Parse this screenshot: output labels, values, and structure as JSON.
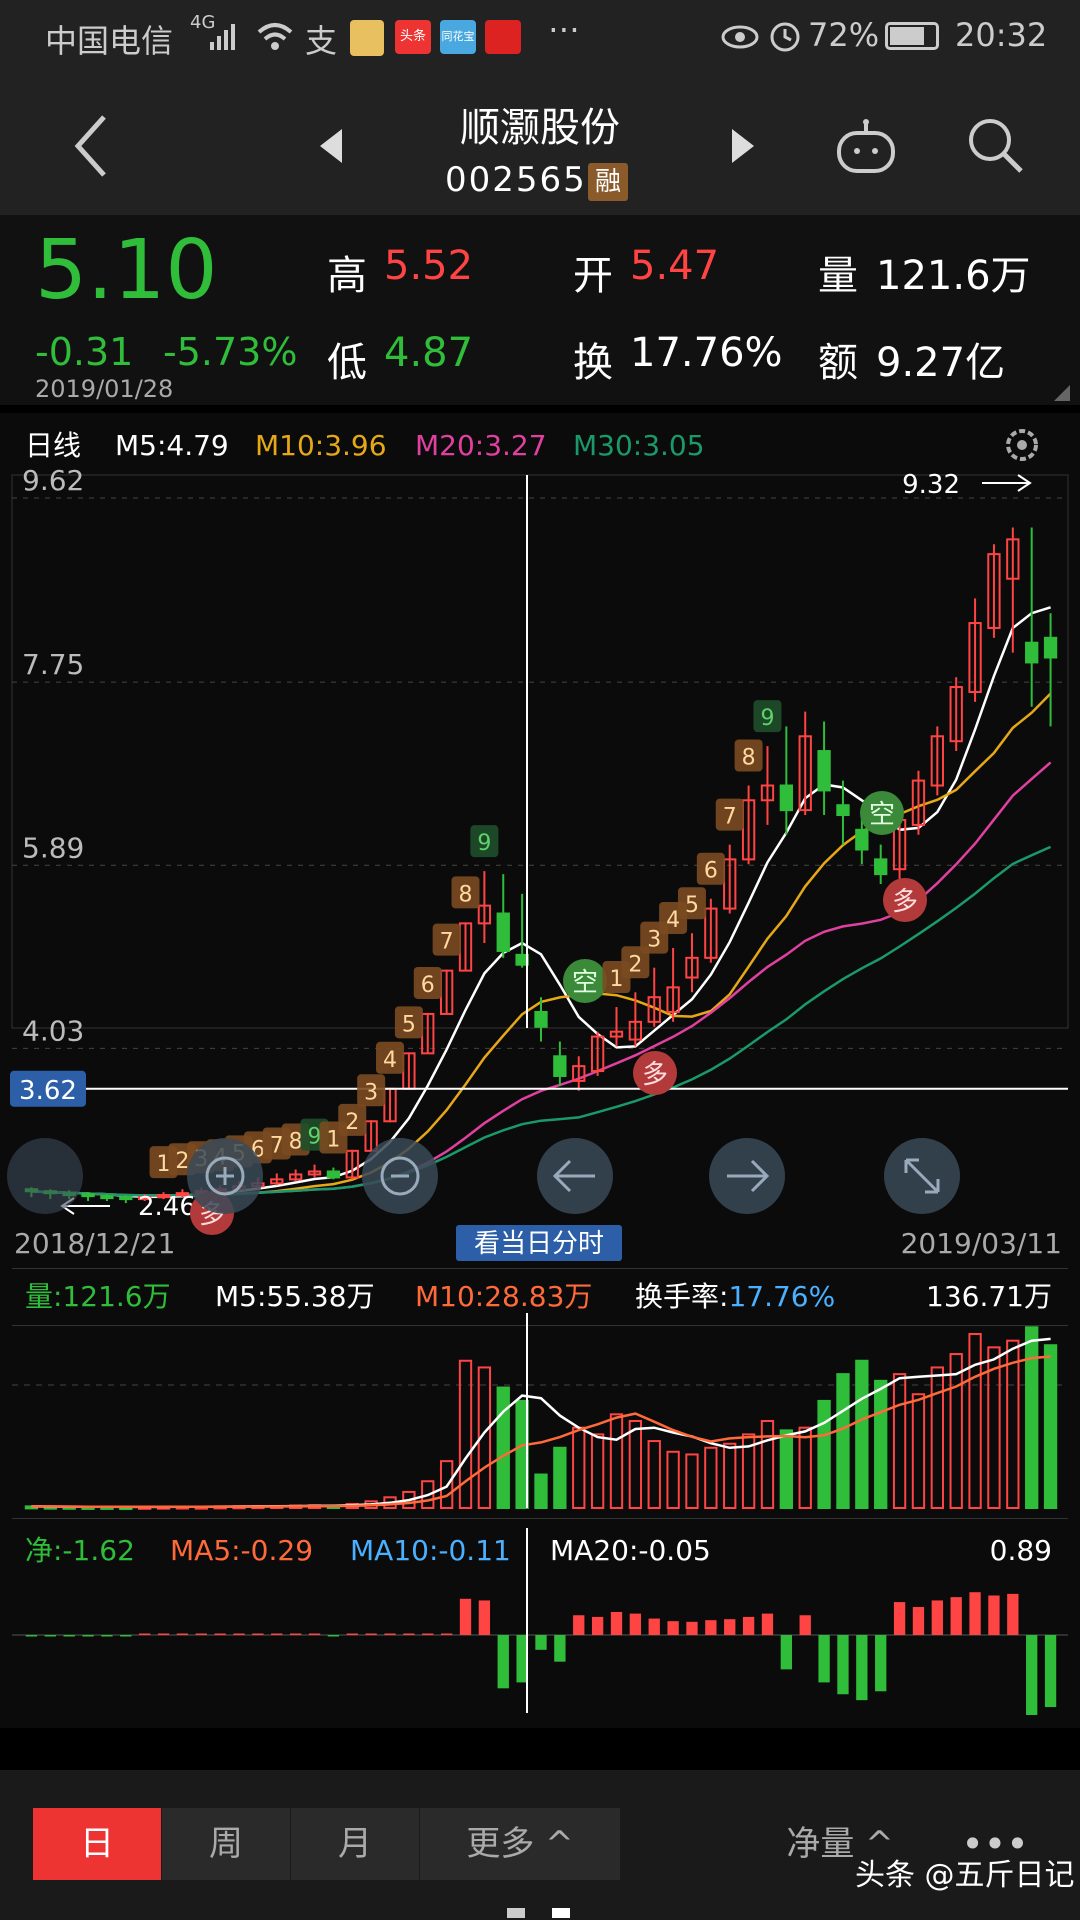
{
  "status": {
    "carrier": "中国电信",
    "signal": "4G",
    "battery": "72%",
    "time": "20:32",
    "apps": [
      "头条",
      "同花宝"
    ]
  },
  "header": {
    "title": "顺灏股份",
    "code": "002565",
    "badge": "融"
  },
  "quote": {
    "price": "5.10",
    "change": "-0.31",
    "change_pct": "-5.73%",
    "date": "2019/01/28",
    "high_label": "高",
    "high": "5.52",
    "open_label": "开",
    "open": "5.47",
    "volume_label": "量",
    "volume": "121.6万",
    "low_label": "低",
    "low": "4.87",
    "turnover_label": "换",
    "turnover": "17.76%",
    "amount_label": "额",
    "amount": "9.27亿"
  },
  "kline": {
    "period_label": "日线",
    "m5": "M5:4.79",
    "m10": "M10:3.96",
    "m20": "M20:3.27",
    "m30": "M30:3.05",
    "y_labels": [
      "9.62",
      "7.75",
      "5.89",
      "4.03"
    ],
    "crosshair_price": "3.62",
    "max_label": "9.32",
    "min_label": "2.46",
    "start_date": "2018/12/21",
    "end_date": "2019/03/11",
    "intraday_button": "看当日分时",
    "sig_duo": "多",
    "sig_kong": "空"
  },
  "volume": {
    "label": "量:121.6万",
    "m5": "M5:55.38万",
    "m10": "M10:28.83万",
    "turnover": "换手率:17.76%",
    "max": "136.71万"
  },
  "net": {
    "label": "净:-1.62",
    "ma5": "MA5:-0.29",
    "ma10": "MA10:-0.11",
    "ma20": "MA20:-0.05",
    "max": "0.89"
  },
  "tabs": [
    "日",
    "周",
    "月",
    "更多"
  ],
  "indicator_selector": "净量",
  "watermark": "头条 @五斤日记",
  "colors": {
    "up": "#ff4444",
    "down": "#2fbd3a",
    "m10": "#e6a817",
    "m20": "#e040a0",
    "m30": "#1a9a6a"
  },
  "chart_data": {
    "type": "candlestick",
    "y_range": [
      2.46,
      9.62
    ],
    "candles": [
      {
        "o": 2.6,
        "c": 2.58,
        "h": 2.62,
        "l": 2.52
      },
      {
        "o": 2.58,
        "c": 2.56,
        "h": 2.6,
        "l": 2.5
      },
      {
        "o": 2.56,
        "c": 2.55,
        "h": 2.59,
        "l": 2.5
      },
      {
        "o": 2.55,
        "c": 2.53,
        "h": 2.57,
        "l": 2.48
      },
      {
        "o": 2.53,
        "c": 2.52,
        "h": 2.55,
        "l": 2.48
      },
      {
        "o": 2.52,
        "c": 2.5,
        "h": 2.54,
        "l": 2.46
      },
      {
        "o": 2.5,
        "c": 2.52,
        "h": 2.55,
        "l": 2.48
      },
      {
        "o": 2.52,
        "c": 2.54,
        "h": 2.57,
        "l": 2.5
      },
      {
        "o": 2.54,
        "c": 2.56,
        "h": 2.6,
        "l": 2.52
      },
      {
        "o": 2.56,
        "c": 2.58,
        "h": 2.62,
        "l": 2.54
      },
      {
        "o": 2.58,
        "c": 2.6,
        "h": 2.64,
        "l": 2.56
      },
      {
        "o": 2.6,
        "c": 2.63,
        "h": 2.68,
        "l": 2.58
      },
      {
        "o": 2.63,
        "c": 2.66,
        "h": 2.72,
        "l": 2.61
      },
      {
        "o": 2.66,
        "c": 2.7,
        "h": 2.76,
        "l": 2.64
      },
      {
        "o": 2.7,
        "c": 2.75,
        "h": 2.8,
        "l": 2.68
      },
      {
        "o": 2.75,
        "c": 2.78,
        "h": 2.85,
        "l": 2.72
      },
      {
        "o": 2.78,
        "c": 2.72,
        "h": 2.82,
        "l": 2.7
      },
      {
        "o": 2.72,
        "c": 2.99,
        "h": 3.0,
        "l": 2.7
      },
      {
        "o": 2.99,
        "c": 3.29,
        "h": 3.3,
        "l": 2.98
      },
      {
        "o": 3.29,
        "c": 3.62,
        "h": 3.63,
        "l": 3.28
      },
      {
        "o": 3.62,
        "c": 3.98,
        "h": 3.99,
        "l": 3.62
      },
      {
        "o": 3.98,
        "c": 4.38,
        "h": 4.39,
        "l": 3.98
      },
      {
        "o": 4.38,
        "c": 4.82,
        "h": 4.83,
        "l": 4.38
      },
      {
        "o": 4.82,
        "c": 5.3,
        "h": 5.31,
        "l": 4.82
      },
      {
        "o": 5.3,
        "c": 5.48,
        "h": 5.83,
        "l": 5.1
      },
      {
        "o": 5.4,
        "c": 5.02,
        "h": 5.8,
        "l": 4.95
      },
      {
        "o": 4.98,
        "c": 4.88,
        "h": 5.6,
        "l": 4.85
      },
      {
        "o": 4.4,
        "c": 4.25,
        "h": 4.55,
        "l": 4.1
      },
      {
        "o": 3.95,
        "c": 3.75,
        "h": 4.1,
        "l": 3.65
      },
      {
        "o": 3.7,
        "c": 3.85,
        "h": 3.95,
        "l": 3.6
      },
      {
        "o": 3.8,
        "c": 4.15,
        "h": 4.2,
        "l": 3.75
      },
      {
        "o": 4.15,
        "c": 4.2,
        "h": 4.45,
        "l": 4.05
      },
      {
        "o": 4.12,
        "c": 4.3,
        "h": 4.6,
        "l": 4.05
      },
      {
        "o": 4.3,
        "c": 4.55,
        "h": 4.85,
        "l": 4.25
      },
      {
        "o": 4.4,
        "c": 4.65,
        "h": 5.05,
        "l": 4.3
      },
      {
        "o": 4.75,
        "c": 4.95,
        "h": 5.2,
        "l": 4.6
      },
      {
        "o": 4.95,
        "c": 5.45,
        "h": 5.55,
        "l": 4.9
      },
      {
        "o": 5.45,
        "c": 5.95,
        "h": 6.1,
        "l": 5.4
      },
      {
        "o": 5.95,
        "c": 6.55,
        "h": 6.7,
        "l": 5.9
      },
      {
        "o": 6.55,
        "c": 6.7,
        "h": 7.1,
        "l": 6.3
      },
      {
        "o": 6.7,
        "c": 6.45,
        "h": 7.3,
        "l": 6.2
      },
      {
        "o": 6.45,
        "c": 7.2,
        "h": 7.45,
        "l": 6.4
      },
      {
        "o": 7.05,
        "c": 6.65,
        "h": 7.35,
        "l": 6.4
      },
      {
        "o": 6.5,
        "c": 6.4,
        "h": 6.75,
        "l": 6.1
      },
      {
        "o": 6.25,
        "c": 6.05,
        "h": 6.45,
        "l": 5.9
      },
      {
        "o": 5.95,
        "c": 5.8,
        "h": 6.1,
        "l": 5.7
      },
      {
        "o": 5.85,
        "c": 6.35,
        "h": 6.45,
        "l": 5.7
      },
      {
        "o": 6.3,
        "c": 6.75,
        "h": 6.85,
        "l": 6.2
      },
      {
        "o": 6.7,
        "c": 7.2,
        "h": 7.3,
        "l": 6.6
      },
      {
        "o": 7.15,
        "c": 7.7,
        "h": 7.8,
        "l": 7.05
      },
      {
        "o": 7.65,
        "c": 8.35,
        "h": 8.6,
        "l": 7.55
      },
      {
        "o": 8.3,
        "c": 9.05,
        "h": 9.15,
        "l": 8.2
      },
      {
        "o": 8.8,
        "c": 9.2,
        "h": 9.32,
        "l": 8.05
      },
      {
        "o": 8.15,
        "c": 7.95,
        "h": 9.32,
        "l": 7.5
      },
      {
        "o": 8.2,
        "c": 8.0,
        "h": 8.45,
        "l": 7.3
      }
    ],
    "volume_values": [
      1.2,
      1.0,
      0.9,
      0.8,
      0.8,
      0.7,
      0.9,
      1.0,
      1.1,
      1.0,
      1.2,
      1.3,
      1.4,
      1.5,
      1.8,
      2.0,
      1.6,
      3.0,
      5.0,
      8.0,
      12.0,
      20.0,
      35.0,
      110.0,
      105.0,
      90.0,
      80.0,
      25.0,
      45.0,
      60.0,
      55.0,
      70.0,
      65.0,
      50.0,
      42.0,
      40.0,
      45.0,
      48.0,
      55.0,
      65.0,
      58.0,
      60.0,
      80.0,
      100.0,
      110.0,
      95.0,
      100.0,
      85.0,
      105.0,
      115.0,
      130.0,
      120.0,
      125.0,
      135.0,
      121.6
    ]
  }
}
